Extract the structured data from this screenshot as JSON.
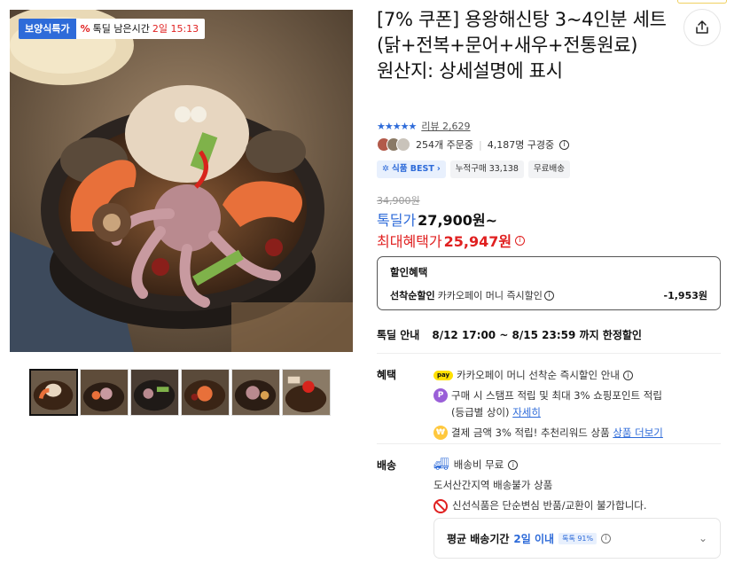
{
  "badges": {
    "category": "보양식특가",
    "timer_icon": "%",
    "timer_label": "톡딜 남은시간",
    "timer_value": "2일 15:13"
  },
  "product": {
    "title": "[7% 쿠폰] 용왕해신탕 3~4인분 세트 (닭+전복+문어+새우+전통원료)\n원산지: 상세설명에 표시",
    "stars": "★★★★★",
    "review_link": "리뷰 2,629",
    "orders": "254개 주문중",
    "subscribers": "4,187명 구경중",
    "chips": [
      "식품 BEST",
      "누적구매 33,138",
      "무료배송"
    ]
  },
  "price": {
    "original": "34,900원",
    "deal_label": "톡딜가",
    "deal_value": "27,900원~",
    "max_label": "최대혜택가",
    "max_value": "25,947원"
  },
  "discount": {
    "heading": "할인혜택",
    "row_key": "선착순할인",
    "row_value": "카카오페이 머니 즉시할인",
    "row_amount": "-1,953원"
  },
  "deal_info": {
    "label": "톡딜 안내",
    "period": "8/12 17:00 ~ 8/15 23:59 까지 한정할인"
  },
  "benefits": {
    "label": "혜택",
    "items": [
      {
        "icon": "pay",
        "text": "카카오페이 머니 선착순 즉시할인 안내"
      },
      {
        "icon": "P",
        "text": "구매 시 스탬프 적립 및 최대 3% 쇼핑포인트 적립",
        "sub": "(등급별 상이)",
        "link": "자세히"
      },
      {
        "icon": "₩",
        "text": "결제 금액 3% 적립! 추천리워드 상품",
        "link": "상품 더보기"
      }
    ]
  },
  "shipping": {
    "label": "배송",
    "fee": "배송비 무료",
    "restriction": "도서산간지역 배송불가 상품",
    "notice": "신선식품은 단순변심 반품/교환이 불가합니다.",
    "avg_label": "평균 배송기간",
    "avg_days": "2일 이내",
    "avg_pill": "톡톡 91%"
  },
  "colors": {
    "accent_blue": "#2e6bd9",
    "accent_red": "#e02020"
  }
}
